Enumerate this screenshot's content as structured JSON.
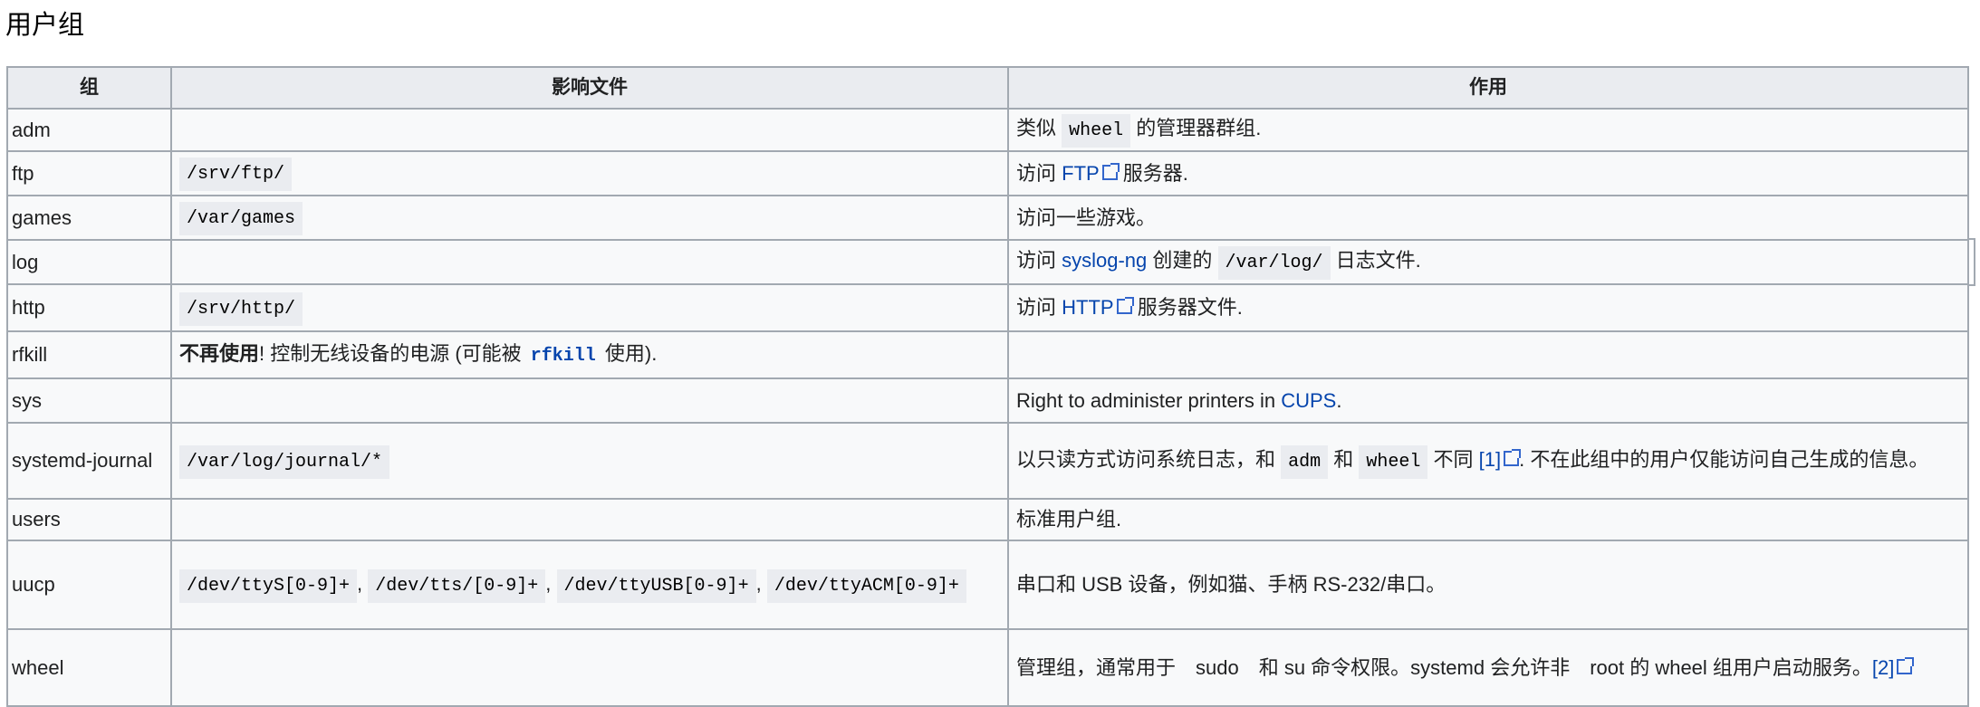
{
  "title": "用户组",
  "headers": [
    "组",
    "影响文件",
    "作用"
  ],
  "rows": [
    {
      "group": "adm",
      "files": [],
      "desc": [
        {
          "t": "类似 "
        },
        {
          "t": "wheel",
          "k": "code"
        },
        {
          "t": " 的管理器群组."
        }
      ]
    },
    {
      "group": "ftp",
      "files": [
        {
          "t": "/srv/ftp/",
          "k": "code"
        }
      ],
      "desc": [
        {
          "t": "访问 "
        },
        {
          "t": "FTP",
          "k": "ext"
        },
        {
          "t": " 服务器."
        }
      ]
    },
    {
      "group": "games",
      "files": [
        {
          "t": "/var/games",
          "k": "code"
        }
      ],
      "desc": [
        {
          "t": "访问一些游戏。"
        }
      ]
    },
    {
      "group": "log",
      "files": [],
      "desc": [
        {
          "t": "访问 "
        },
        {
          "t": "syslog-ng",
          "k": "link"
        },
        {
          "t": " 创建的 "
        },
        {
          "t": "/var/log/",
          "k": "code"
        },
        {
          "t": " 日志文件."
        }
      ]
    },
    {
      "group": "http",
      "files": [
        {
          "t": "/srv/http/",
          "k": "code"
        }
      ],
      "desc": [
        {
          "t": "访问 "
        },
        {
          "t": "HTTP",
          "k": "ext"
        },
        {
          "t": " 服务器文件."
        }
      ]
    },
    {
      "group": "rfkill",
      "files": [
        {
          "t": "不再使用",
          "k": "bold"
        },
        {
          "t": "! 控制无线设备的电源 (可能被 "
        },
        {
          "t": "rfkill",
          "k": "boldlink"
        },
        {
          "t": " 使用)."
        }
      ],
      "desc": []
    },
    {
      "group": "sys",
      "files": [],
      "desc": [
        {
          "t": "Right to administer printers in "
        },
        {
          "t": "CUPS",
          "k": "link"
        },
        {
          "t": "."
        }
      ]
    },
    {
      "group": "systemd-journal",
      "files": [
        {
          "t": "/var/log/journal/*",
          "k": "code"
        }
      ],
      "desc": [
        {
          "t": "以只读方式访问系统日志，和 "
        },
        {
          "t": "adm",
          "k": "code"
        },
        {
          "t": " 和 "
        },
        {
          "t": "wheel",
          "k": "code"
        },
        {
          "t": " 不同 "
        },
        {
          "t": "[1]",
          "k": "ext"
        },
        {
          "t": ". 不在此组中的用户仅能访问自己生成的信息。"
        }
      ]
    },
    {
      "group": "users",
      "files": [],
      "desc": [
        {
          "t": "标准用户组."
        }
      ]
    },
    {
      "group": "uucp",
      "files": [
        {
          "t": "/dev/ttyS[0-9]+",
          "k": "code"
        },
        {
          "t": ", "
        },
        {
          "t": "/dev/tts/[0-9]+",
          "k": "code"
        },
        {
          "t": ", "
        },
        {
          "t": "/dev/ttyUSB[0-9]+",
          "k": "code"
        },
        {
          "t": ", "
        },
        {
          "t": "/dev/ttyACM[0-9]+",
          "k": "code"
        }
      ],
      "desc": [
        {
          "t": "串口和 USB 设备，例如猫、手柄 RS-232/串口。"
        }
      ]
    },
    {
      "group": "wheel",
      "files": [],
      "desc": [
        {
          "t": "管理组，通常用于　sudo　和 su 命令权限。systemd 会允许非　root 的 wheel 组用户启动服务。"
        },
        {
          "t": "[2]",
          "k": "ext"
        }
      ]
    }
  ]
}
